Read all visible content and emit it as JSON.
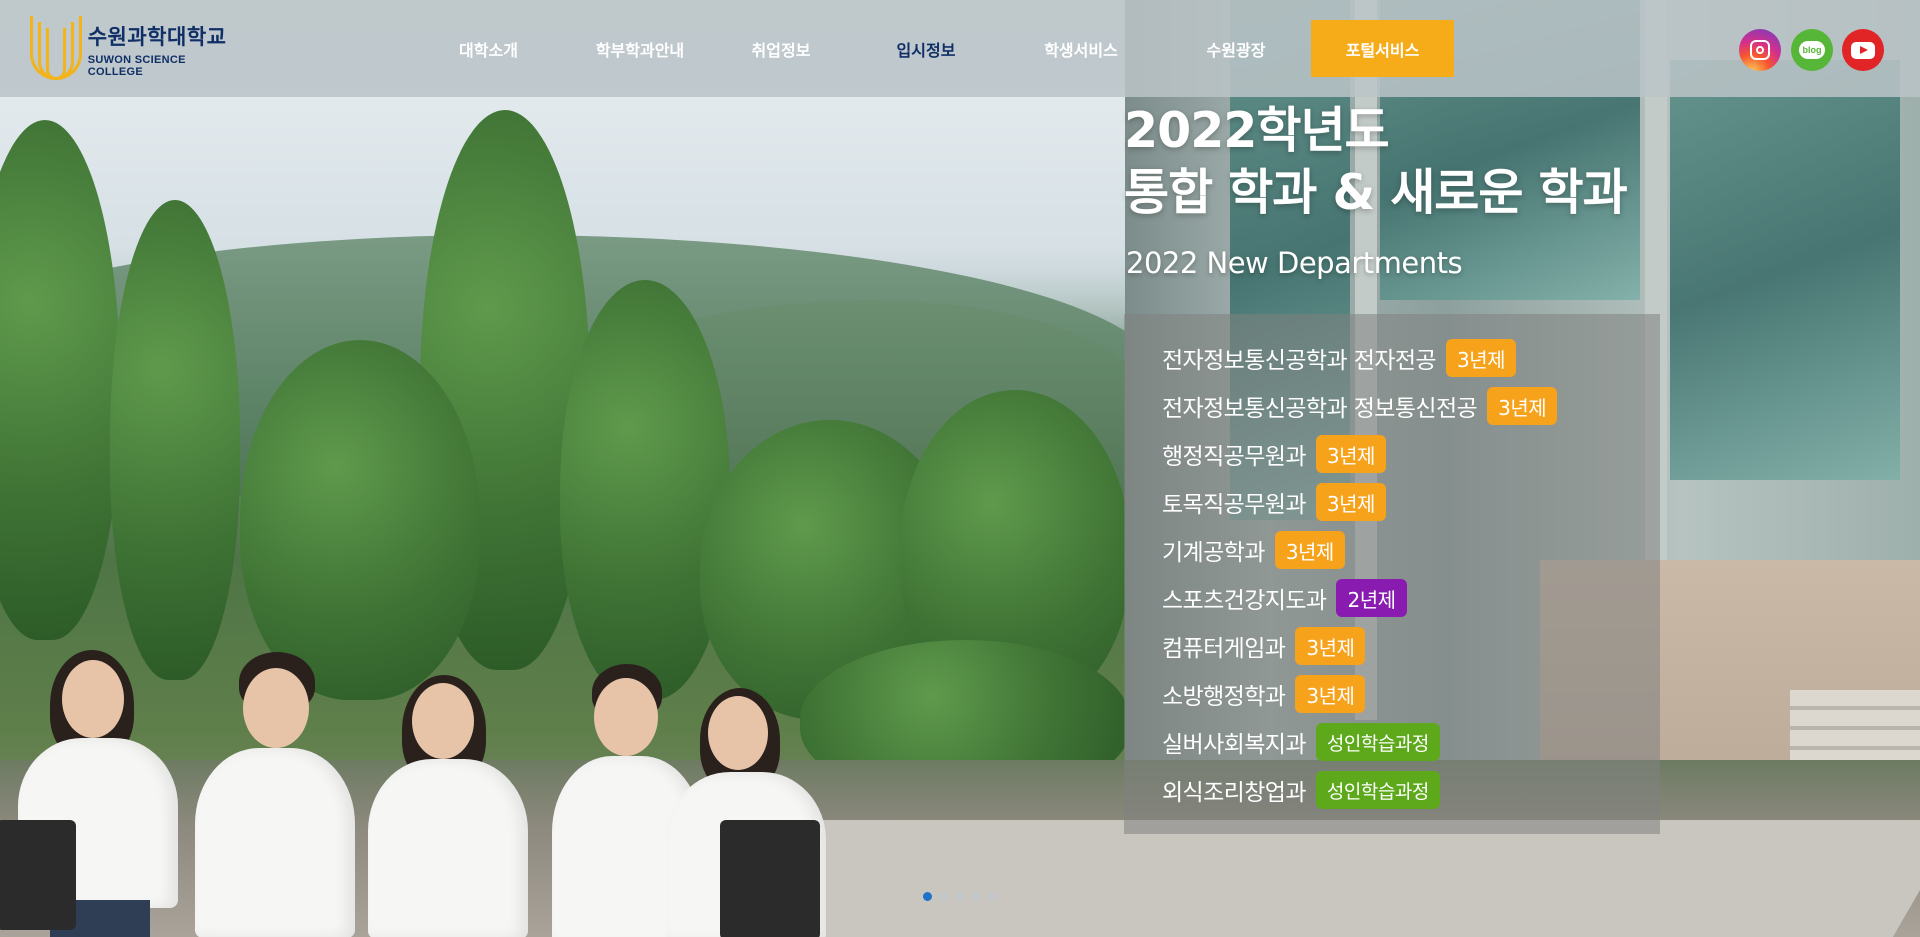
{
  "header": {
    "logo": {
      "name_ko": "수원과학대학교",
      "name_en": "SUWON SCIENCE COLLEGE"
    },
    "nav": [
      {
        "label": "대학소개",
        "active": false
      },
      {
        "label": "학부학과안내",
        "active": false
      },
      {
        "label": "취업정보",
        "active": false
      },
      {
        "label": "입시정보",
        "active": true
      },
      {
        "label": "학생서비스",
        "active": false
      },
      {
        "label": "수원광장",
        "active": false
      },
      {
        "label": "포털서비스",
        "active": false,
        "highlight": true
      }
    ],
    "social": [
      {
        "icon": "instagram-icon"
      },
      {
        "icon": "blog-icon",
        "text": "blog"
      },
      {
        "icon": "youtube-icon"
      }
    ]
  },
  "hero": {
    "title_line1": "2022학년도",
    "title_line2": "통합 학과 & 새로운 학과",
    "subtitle": "2022 New Departments",
    "departments": [
      {
        "name": "전자정보통신공학과 전자전공",
        "badge": "3년제",
        "badge_color": "#f7a21b"
      },
      {
        "name": "전자정보통신공학과 정보통신전공",
        "badge": "3년제",
        "badge_color": "#f7a21b"
      },
      {
        "name": "행정직공무원과",
        "badge": "3년제",
        "badge_color": "#f7a21b"
      },
      {
        "name": "토목직공무원과",
        "badge": "3년제",
        "badge_color": "#f7a21b"
      },
      {
        "name": "기계공학과",
        "badge": "3년제",
        "badge_color": "#f7a21b"
      },
      {
        "name": "스포츠건강지도과",
        "badge": "2년제",
        "badge_color": "#8a1bb1"
      },
      {
        "name": "컴퓨터게임과",
        "badge": "3년제",
        "badge_color": "#f7a21b"
      },
      {
        "name": "소방행정학과",
        "badge": "3년제",
        "badge_color": "#f7a21b"
      },
      {
        "name": "실버사회복지과",
        "badge": "성인학습과정",
        "badge_color": "#5ea91b"
      },
      {
        "name": "외식조리창업과",
        "badge": "성인학습과정",
        "badge_color": "#5ea91b"
      }
    ]
  },
  "slider": {
    "total": 5,
    "active_index": 0
  },
  "colors": {
    "brand_navy": "#0f2f66",
    "brand_gold": "#f2b31b",
    "portal_orange": "#f6ab18",
    "dot_active": "#1e72c8"
  }
}
